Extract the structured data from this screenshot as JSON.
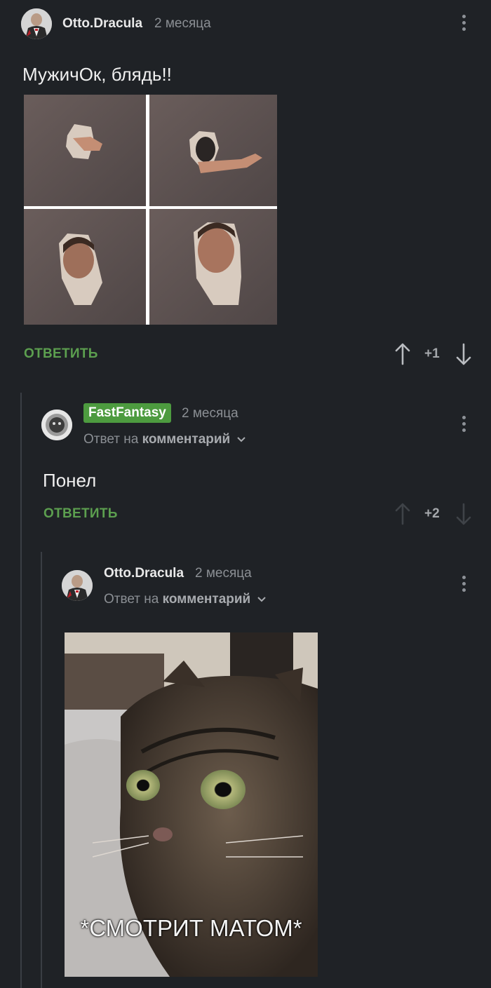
{
  "comment1": {
    "author": "Otto.Dracula",
    "time": "2 месяца",
    "text": "МужичОк, блядь!!",
    "reply_label": "ОТВЕТИТЬ",
    "score": "+1"
  },
  "comment2": {
    "author": "FastFantasy",
    "time": "2 месяца",
    "reply_to_prefix": "Ответ на",
    "reply_to_link": "комментарий",
    "text": "Понел",
    "reply_label": "ОТВЕТИТЬ",
    "score": "+2"
  },
  "comment3": {
    "author": "Otto.Dracula",
    "time": "2 месяца",
    "reply_to_prefix": "Ответ на",
    "reply_to_link": "комментарий",
    "image_caption": "*СМОТРИТ МАТОМ*"
  },
  "colors": {
    "background": "#1f2226",
    "accent_green": "#5c9f4f",
    "badge_green": "#4d9b3f"
  }
}
